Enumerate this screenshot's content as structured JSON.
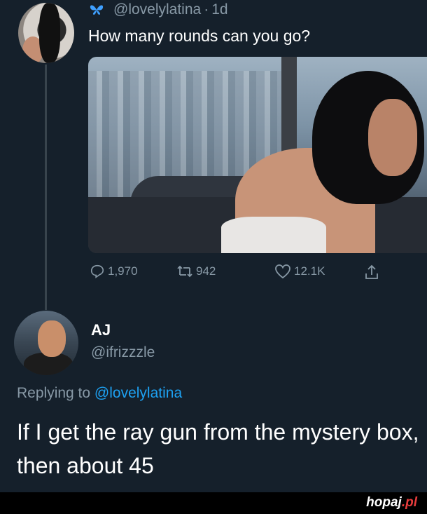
{
  "tweet": {
    "handle": "@lovelylatina",
    "separator": "·",
    "time": "1d",
    "text": "How many rounds can you go?",
    "stats": {
      "replies": "1,970",
      "retweets": "942",
      "likes": "12.1K"
    }
  },
  "reply": {
    "name": "AJ",
    "handle": "@ifrizzzle",
    "replying_prefix": "Replying to",
    "replying_to": "@lovelylatina",
    "text": "If I get the ray gun from the mystery box, then about 45"
  },
  "watermark": {
    "name": "hopaj",
    "tld": ".pl"
  },
  "colors": {
    "background": "#15202b",
    "secondary_text": "#8899a6",
    "accent": "#1da1f2",
    "watermark_accent": "#e63c3c"
  }
}
